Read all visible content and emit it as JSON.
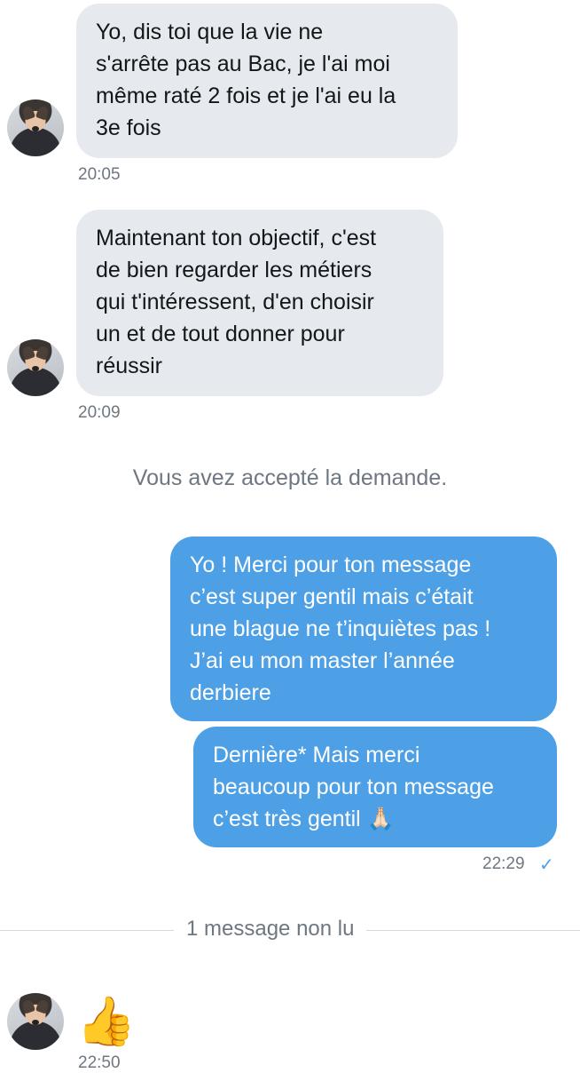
{
  "messages": {
    "m1": {
      "text": "Yo, dis toi que la vie ne\ns'arrête pas au Bac, je l'ai moi\nmême raté 2 fois et je l'ai eu la\n3e fois",
      "time": "20:05"
    },
    "m2": {
      "text": "Maintenant ton objectif, c'est\nde bien regarder les métiers\nqui t'intéressent, d'en choisir\nun et de tout donner pour\nréussir",
      "time": "20:09"
    },
    "system": "Vous avez accepté la demande.",
    "m3": {
      "text": "Yo ! Merci pour ton message\nc’est super gentil mais c’était\nune blague ne t’inquiètes pas !\nJ’ai eu mon master l’année\nderbiere"
    },
    "m4": {
      "text": "Dernière* Mais merci\nbeaucoup pour ton message\nc’est très gentil 🙏🏻",
      "time": "22:29",
      "status": "✓"
    },
    "unread_divider": "1 message non lu",
    "m5": {
      "emoji": "👍",
      "time": "22:50"
    }
  },
  "colors": {
    "incoming_bubble": "#e6e9ee",
    "outgoing_bubble": "#4ea0e6",
    "timestamp": "#6e7781"
  }
}
